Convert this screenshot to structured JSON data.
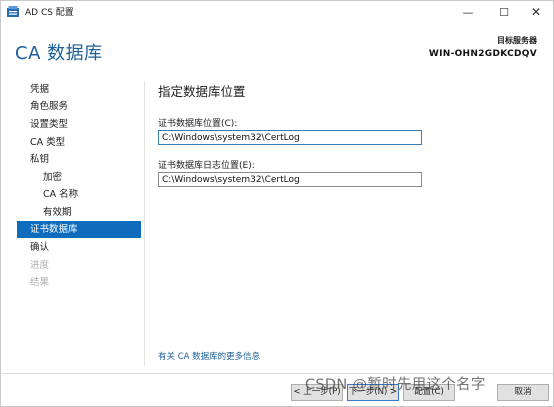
{
  "window": {
    "title": "AD CS 配置",
    "icon": "server-manager-icon",
    "controls": {
      "minimize": "—",
      "maximize": "☐",
      "close": "✕"
    }
  },
  "header": {
    "title": "CA 数据库",
    "target_label": "目标服务器",
    "target_server": "WIN-OHN2GDKCDQV"
  },
  "sidebar": {
    "items": [
      {
        "label": "凭据",
        "state": "normal",
        "level": 0
      },
      {
        "label": "角色服务",
        "state": "normal",
        "level": 0
      },
      {
        "label": "设置类型",
        "state": "normal",
        "level": 0
      },
      {
        "label": "CA 类型",
        "state": "normal",
        "level": 0
      },
      {
        "label": "私钥",
        "state": "normal",
        "level": 0
      },
      {
        "label": "加密",
        "state": "normal",
        "level": 1
      },
      {
        "label": "CA 名称",
        "state": "normal",
        "level": 1
      },
      {
        "label": "有效期",
        "state": "normal",
        "level": 1
      },
      {
        "label": "证书数据库",
        "state": "active",
        "level": 0
      },
      {
        "label": "确认",
        "state": "normal",
        "level": 0
      },
      {
        "label": "进度",
        "state": "disabled",
        "level": 0
      },
      {
        "label": "结果",
        "state": "disabled",
        "level": 0
      }
    ]
  },
  "main": {
    "title": "指定数据库位置",
    "db_label": "证书数据库位置(C):",
    "db_value": "C:\\Windows\\system32\\CertLog",
    "log_label": "证书数据库日志位置(E):",
    "log_value": "C:\\Windows\\system32\\CertLog",
    "more_link": "有关 CA 数据库的更多信息"
  },
  "footer": {
    "prev": "< 上一步(P)",
    "next": "下一步(N) >",
    "configure": "配置(C)",
    "cancel": "取消"
  },
  "watermark": "CSDN @暂时先用这个名字",
  "colors": {
    "accent": "#1b5e98",
    "active_bg": "#0f6cbd"
  }
}
